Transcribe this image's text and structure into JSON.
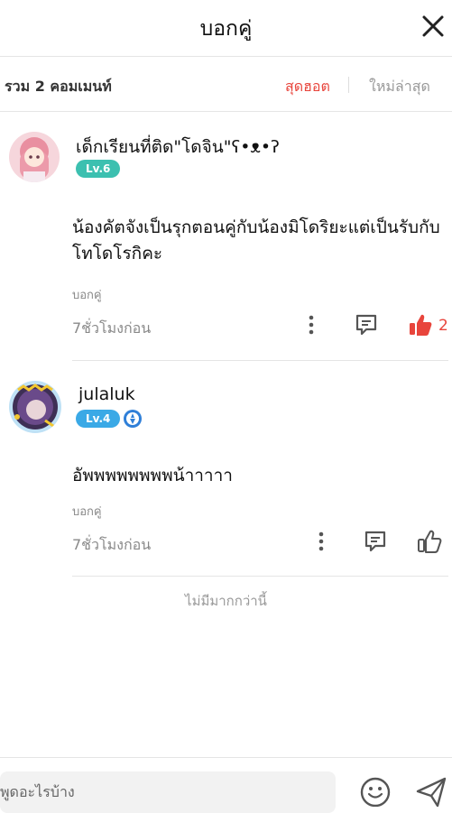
{
  "header": {
    "title": "บอกคู่"
  },
  "sort": {
    "count_label": "รวม 2 คอมเมนท์",
    "hot": "สุดฮอต",
    "newest": "ใหม่ล่าสุด"
  },
  "comments": [
    {
      "username": "เด็กเรียนที่ติด\"โดจิน\"ʕ•ᴥ•ʔ",
      "level": "Lv.6",
      "text": "น้องคัตจังเป็นรุกตอนคู่กับน้องมิโดริยะแต่เป็นรับกับโทโดโรกิคะ",
      "tag": "บอกคู่",
      "time": "7ชั่วโมงก่อน",
      "likes": "2"
    },
    {
      "username": "julaluk",
      "level": "Lv.4",
      "text": "อัพพพพพพพพน้าาาาา",
      "tag": "บอกคู่",
      "time": "7ชั่วโมงก่อน"
    }
  ],
  "footer": {
    "no_more": "ไม่มีมากกว่านี้"
  },
  "input": {
    "placeholder": "พูดอะไรบ้าง"
  },
  "colors": {
    "accent": "#e8453c",
    "level6": "#3cc0b0",
    "level4": "#3aa9e6",
    "verified": "#2f7fd8"
  }
}
